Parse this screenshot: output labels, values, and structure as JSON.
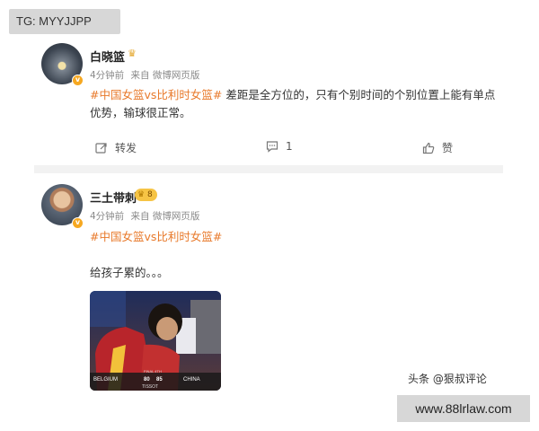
{
  "watermark": {
    "top_left": "TG: MYYJJPP",
    "bottom_right": "www.88lrlaw.com",
    "source": "头条 @狠叔评论"
  },
  "posts": [
    {
      "username": "白晓篮",
      "time": "4分钟前",
      "source": "来自 微博网页版",
      "hashtag": "#中国女篮vs比利时女篮#",
      "text_line1": "差距是全方位的，只有个别时间的个别位置上能有单点",
      "text_line2": "优势，输球很正常。",
      "actions": {
        "repost_label": "转发",
        "comment_count": "1",
        "like_label": "赞"
      },
      "badge_icon": "crown-icon",
      "verify_icon": "v-verified-icon"
    },
    {
      "username": "三土带刺",
      "level": "8",
      "time": "4分钟前",
      "source": "来自 微博网页版",
      "hashtag": "#中国女篮vs比利时女篮#",
      "text": "给孩子累的。。。",
      "image": {
        "scoreboard": {
          "team_left": "BELGIUM",
          "team_right": "CHINA",
          "score_left": "80",
          "score_right": "85",
          "label": "FINAL 4TH",
          "sponsor": "TISSOT"
        }
      },
      "verify_icon": "v-verified-icon"
    }
  ],
  "colors": {
    "hashtag": "#e8792a",
    "badge_gold": "#f6c445",
    "page_gap": "#f2f2f2"
  }
}
